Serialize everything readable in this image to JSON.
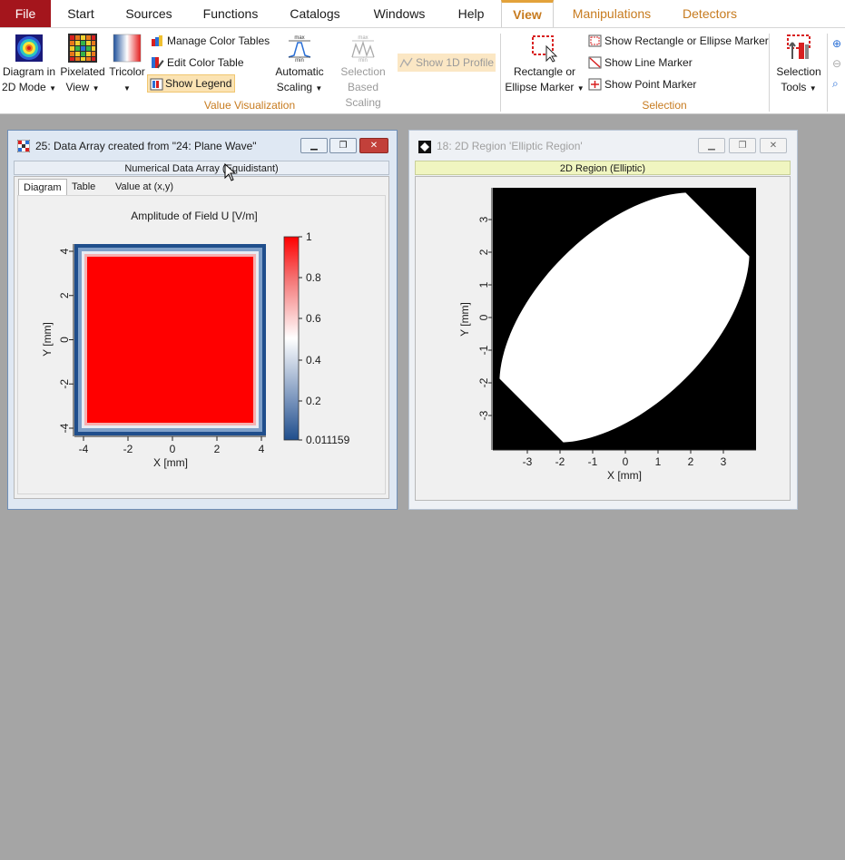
{
  "tabs": {
    "file": "File",
    "start": "Start",
    "sources": "Sources",
    "functions": "Functions",
    "catalogs": "Catalogs",
    "windows": "Windows",
    "help": "Help",
    "view": "View",
    "manipulations": "Manipulations",
    "detectors": "Detectors"
  },
  "ribbon": {
    "diagram_mode": {
      "line1": "Diagram in",
      "line2": "2D Mode"
    },
    "pixelated_view": {
      "line1": "Pixelated",
      "line2": "View"
    },
    "tricolor": {
      "line1": "Tricolor"
    },
    "manage_color_tables": "Manage Color Tables",
    "edit_color_table": "Edit Color Table",
    "show_legend": "Show Legend",
    "automatic_scaling": {
      "line1": "Automatic",
      "line2": "Scaling",
      "icon_top": "max",
      "icon_bottom": "min"
    },
    "selection_based_scaling": {
      "line1": "Selection",
      "line2": "Based Scaling",
      "icon_top": "max",
      "icon_bottom": "min"
    },
    "show_1d_profile": "Show 1D Profile",
    "group_value_visualization": "Value Visualization",
    "rectangle_marker": {
      "line1": "Rectangle or",
      "line2": "Ellipse Marker"
    },
    "show_rect_marker": "Show Rectangle or Ellipse Marker",
    "show_line_marker": "Show Line Marker",
    "show_point_marker": "Show Point Marker",
    "selection_tools": {
      "line1": "Selection",
      "line2": "Tools"
    },
    "group_selection": "Selection"
  },
  "window1": {
    "title": "25: Data Array created from \"24: Plane Wave\"",
    "subtitle": "Numerical Data Array (Equidistant)",
    "tabs": [
      "Diagram",
      "Table",
      "Value at (x,y)"
    ],
    "plot_title": "Amplitude of Field U  [V/m]",
    "xlabel": "X [mm]",
    "ylabel": "Y [mm]",
    "xticks": [
      "-4",
      "-2",
      "0",
      "2",
      "4"
    ],
    "yticks": [
      "4",
      "2",
      "0",
      "-2",
      "-4"
    ],
    "legend_labels": [
      "1",
      "0.8",
      "0.6",
      "0.4",
      "0.2",
      "0.011159"
    ]
  },
  "window2": {
    "title": "18: 2D Region 'Elliptic Region'",
    "subtitle": "2D Region (Elliptic)",
    "xlabel": "X [mm]",
    "ylabel": "Y [mm]",
    "xticks": [
      "-3",
      "-2",
      "-1",
      "0",
      "1",
      "2",
      "3"
    ],
    "yticks": [
      "3",
      "2",
      "1",
      "0",
      "-1",
      "-2",
      "-3"
    ]
  },
  "colors": {
    "file_tab": "#a4151c",
    "accent": "#c77b1f",
    "field_red": "#ff0000",
    "field_blue": "#1f4e8c",
    "subhead_yellow": "#f0f5c0",
    "background": "#a5a5a5"
  }
}
